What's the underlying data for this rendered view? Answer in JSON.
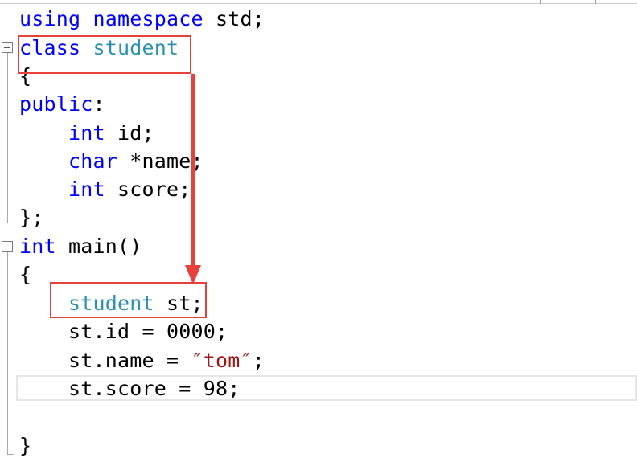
{
  "code": {
    "line1": [
      "using",
      " ",
      "namespace",
      " std;"
    ],
    "line2": [
      "class",
      " ",
      "student"
    ],
    "line3": "{",
    "line4": [
      "public",
      ":"
    ],
    "line5": [
      "    ",
      "int",
      " id;"
    ],
    "line6": [
      "    ",
      "char",
      " *name;"
    ],
    "line7": [
      "    ",
      "int",
      " score;"
    ],
    "line8": "};",
    "line9": [
      "int",
      " main()"
    ],
    "line10": "{",
    "line11": [
      "    ",
      "student",
      " st;"
    ],
    "line12": "    st.id = 0000;",
    "line13": [
      "    st.name = ",
      "″tom″",
      ";"
    ],
    "line14": "    st.score = 98;",
    "line15": "",
    "line16": "}"
  },
  "colors": {
    "keyword": "#0000ff",
    "type": "#2b91af",
    "string": "#a31515",
    "annotation": "#e8403a"
  },
  "icons": [
    "fold-collapse-icon",
    "arrow-annotation"
  ]
}
